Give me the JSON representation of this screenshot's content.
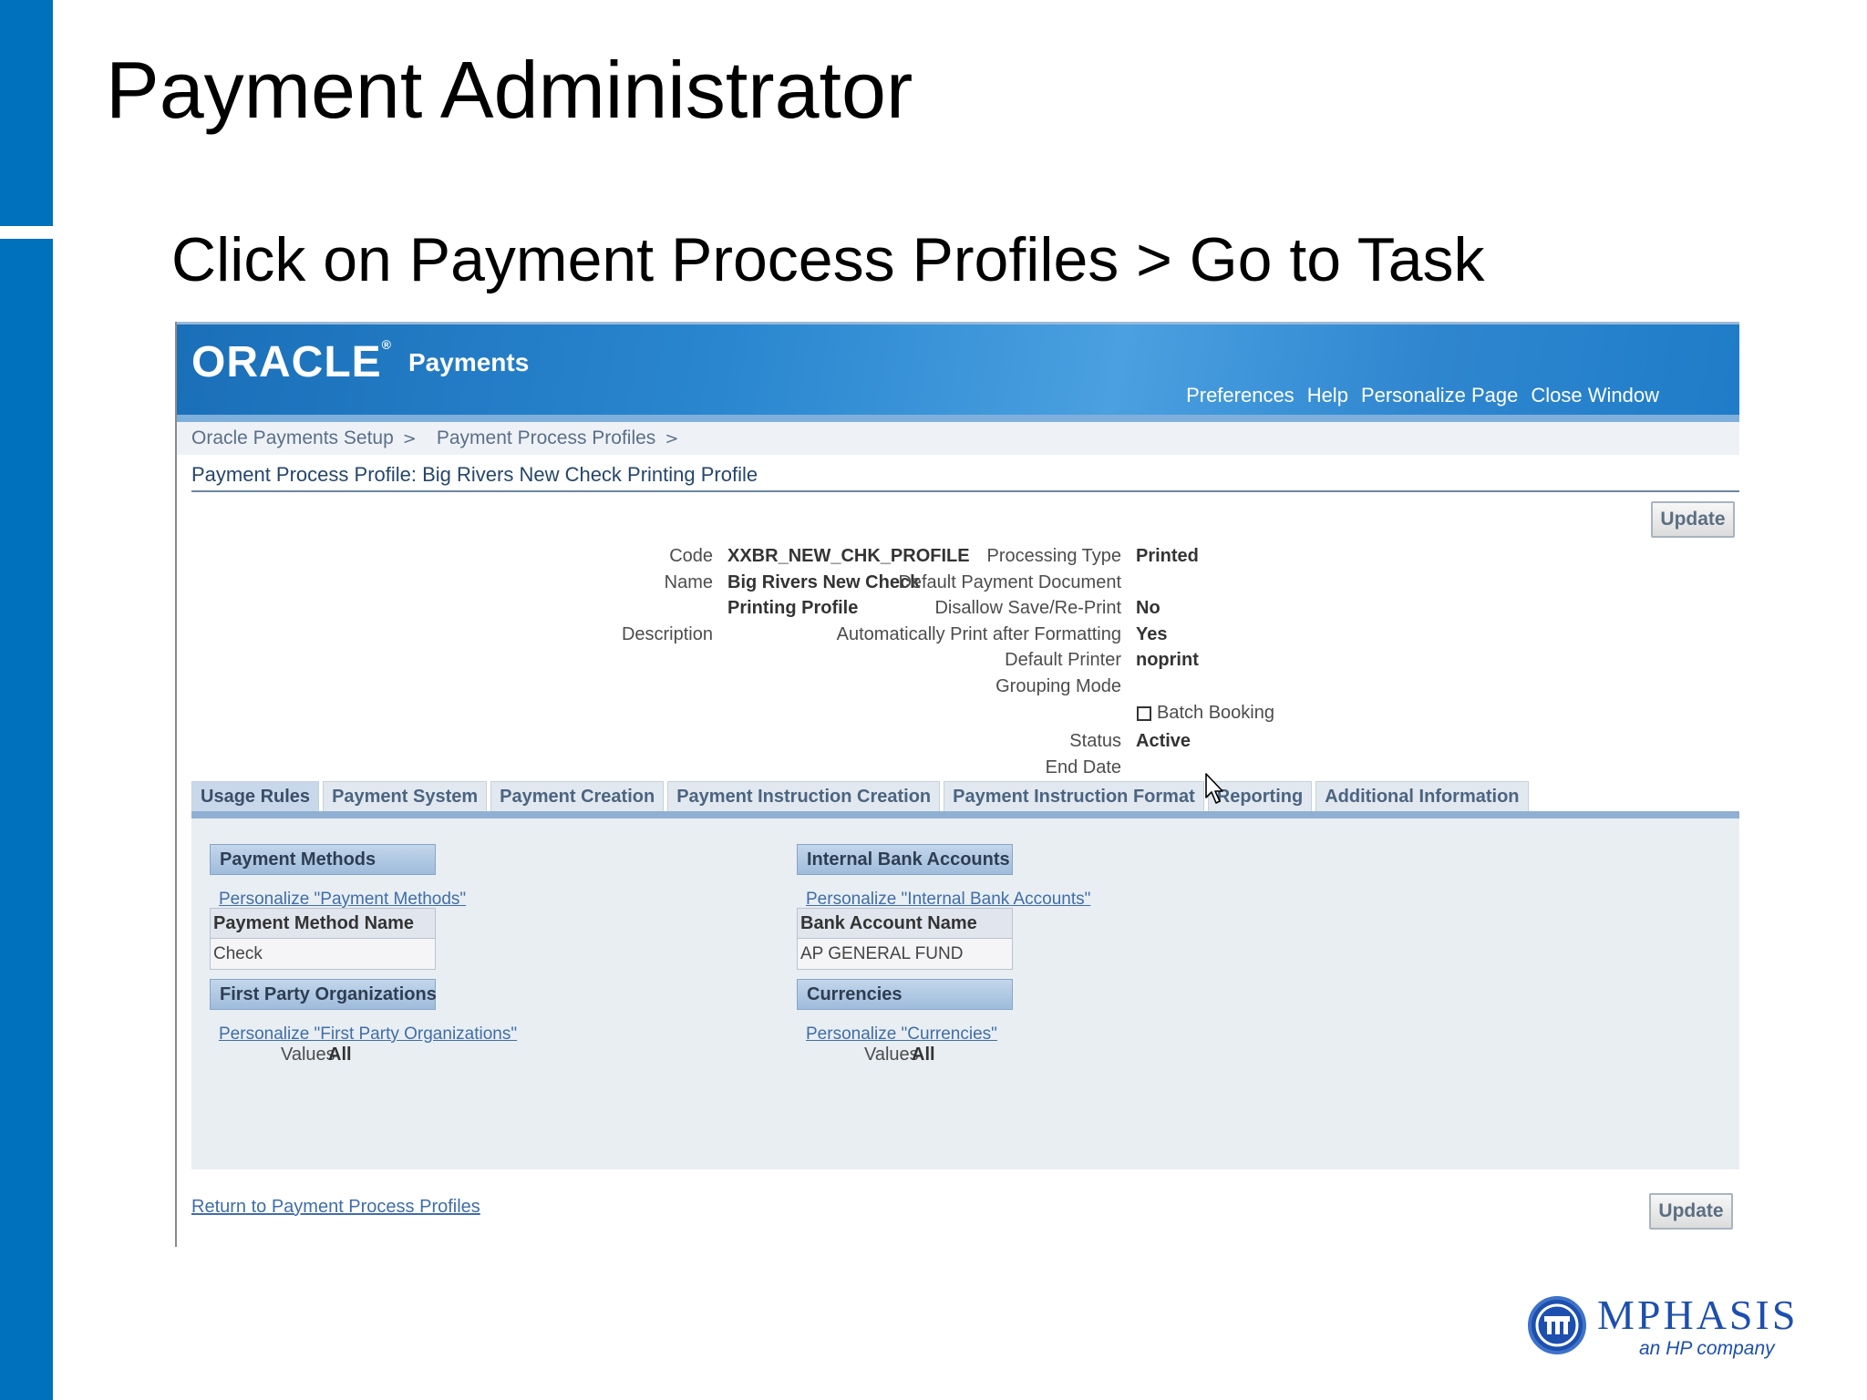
{
  "slide": {
    "title": "Payment Administrator",
    "subtitle": "Click on Payment Process Profiles > Go to Task"
  },
  "oracle": {
    "logo": "ORACLE",
    "product": "Payments",
    "global_links": [
      "Preferences",
      "Help",
      "Personalize Page",
      "Close Window"
    ],
    "breadcrumbs": [
      "Oracle Payments Setup",
      "Payment Process Profiles"
    ],
    "crumb_sep": ">",
    "page_heading": "Payment Process Profile: Big Rivers New Check Printing Profile",
    "update_label": "Update",
    "fields_left": {
      "code_label": "Code",
      "code_value": "XXBR_NEW_CHK_PROFILE",
      "name_label": "Name",
      "name_value_line1": "Big Rivers New Check",
      "name_value_line2": "Printing Profile",
      "description_label": "Description"
    },
    "fields_right": {
      "processing_type_label": "Processing Type",
      "processing_type_value": "Printed",
      "default_payment_document_label": "Default Payment Document",
      "disallow_label": "Disallow Save/Re-Print",
      "disallow_value": "No",
      "auto_print_label": "Automatically Print after Formatting",
      "auto_print_value": "Yes",
      "default_printer_label": "Default Printer",
      "default_printer_value": "noprint",
      "grouping_mode_label": "Grouping Mode",
      "batch_booking_label": "Batch Booking",
      "batch_booking_checked": false,
      "status_label": "Status",
      "status_value": "Active",
      "end_date_label": "End Date"
    },
    "tabs": [
      "Usage Rules",
      "Payment System",
      "Payment Creation",
      "Payment Instruction Creation",
      "Payment Instruction Format",
      "Reporting",
      "Additional Information"
    ],
    "active_tab": "Usage Rules",
    "sections": {
      "payment_methods": {
        "title": "Payment Methods",
        "personalize": "Personalize \"Payment Methods\"",
        "column": "Payment Method Name",
        "rows": [
          "Check"
        ]
      },
      "internal_bank_accounts": {
        "title": "Internal Bank Accounts",
        "personalize": "Personalize \"Internal Bank Accounts\"",
        "column": "Bank Account Name",
        "rows": [
          "AP GENERAL FUND"
        ]
      },
      "first_party_orgs": {
        "title": "First Party Organizations",
        "personalize": "Personalize \"First Party Organizations\"",
        "values_label": "Values",
        "values_value": "All"
      },
      "currencies": {
        "title": "Currencies",
        "personalize": "Personalize \"Currencies\"",
        "values_label": "Values",
        "values_value": "All"
      }
    },
    "return_link": "Return to Payment Process Profiles"
  },
  "footer_logo": {
    "name": "MPHASIS",
    "tagline": "an HP company"
  },
  "colors": {
    "slide_accent": "#0071bc",
    "oracle_header": "#2a86cf",
    "link": "#3f6ea8",
    "panel_bg": "#e9eef3",
    "logo_blue": "#1d4fae"
  }
}
